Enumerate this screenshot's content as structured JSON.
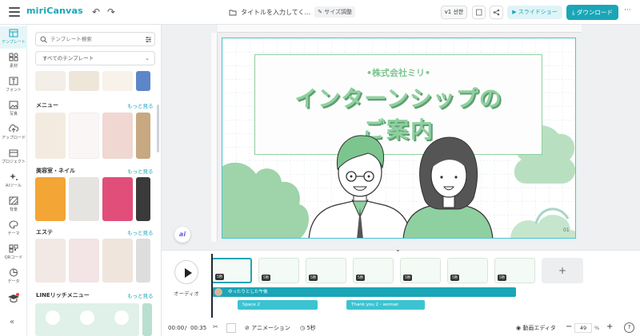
{
  "app": {
    "logo": "miriCanvas",
    "title": "タイトルを入力してく...",
    "resize_label": "サイズ調整"
  },
  "topbar": {
    "version_label": "v1 선한",
    "slideshow_label": "スライドショー",
    "download_label": "ダウンロード",
    "more_label": "···"
  },
  "rail": {
    "items": [
      "テンプレート",
      "素材",
      "フォント",
      "写真",
      "アップロード",
      "プロジェクト",
      "AIツール",
      "背景",
      "テーマ",
      "QRコード",
      "データ"
    ],
    "active": "テンプレート",
    "collapse_label": "«"
  },
  "panel": {
    "search_placeholder": "テンプレート検索",
    "filter_value": "すべてのテンプレート",
    "sections": [
      {
        "title": "メニュー",
        "more": "もっと見る"
      },
      {
        "title": "美容室・ネイル",
        "more": "もっと見る"
      },
      {
        "title": "エステ",
        "more": "もっと見る"
      },
      {
        "title": "LINEリッチメニュー",
        "more": "もっと見る"
      }
    ]
  },
  "slide": {
    "company": "•株式会社ミリ•",
    "headline1": "インターンシップの",
    "headline2": "ご案内",
    "page_number": "01"
  },
  "ai_label": "ai",
  "timeline": {
    "audio_label": "オーディオ",
    "scenes": [
      "5秒",
      "5秒",
      "5秒",
      "5秒",
      "5秒",
      "5秒",
      "5秒"
    ],
    "add_label": "+",
    "audio_track": "ゆったりとした午後",
    "se_tracks": [
      "Space 2",
      "Thank you 2 - woman"
    ],
    "time_current": "00:00",
    "time_separator": "/",
    "time_total": "00:35",
    "animation_label": "アニメーション",
    "duration_label": "5秒",
    "video_editor_label": "動画エディタ",
    "zoom_value": "49",
    "zoom_unit": "%",
    "help_label": "?"
  },
  "colors": {
    "accent": "#1aa6b7",
    "green": "#8fd0a0"
  }
}
